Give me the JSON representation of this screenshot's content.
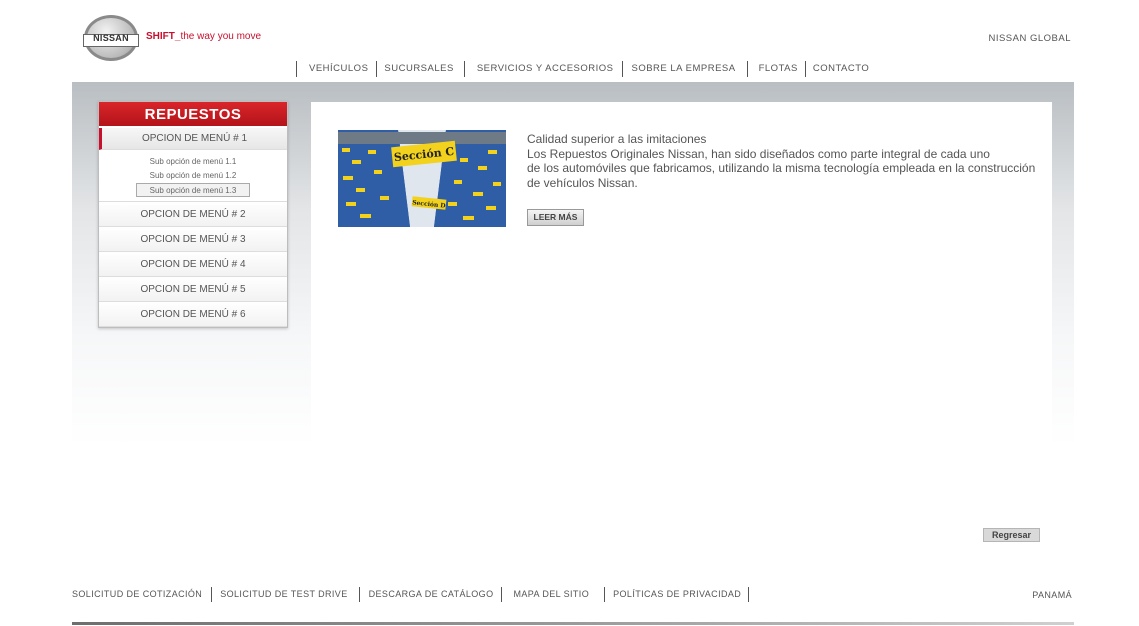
{
  "brand": {
    "logo_text": "NISSAN",
    "tagline_bold": "SHIFT_",
    "tagline_rest": "the way you move",
    "global_link": "NISSAN GLOBAL",
    "accent_color": "#c8102e"
  },
  "topnav": [
    "VEHÍCULOS",
    "SUCURSALES",
    "SERVICIOS Y ACCESORIOS",
    "SOBRE LA EMPRESA",
    "FLOTAS",
    "CONTACTO"
  ],
  "sidebar": {
    "title": "REPUESTOS",
    "items": [
      {
        "label": "OPCION DE MENÚ # 1"
      },
      {
        "label": "OPCION DE MENÚ # 2"
      },
      {
        "label": "OPCION DE MENÚ # 3"
      },
      {
        "label": "OPCION DE MENÚ # 4"
      },
      {
        "label": "OPCION DE MENÚ # 5"
      },
      {
        "label": "OPCION DE MENÚ # 6"
      }
    ],
    "subitems": [
      "Sub opción de menú 1.1",
      "Sub opción de menú 1.2",
      "Sub opción de menú 1.3"
    ]
  },
  "main": {
    "headline": "Calidad superior a las imitaciones",
    "body_lines": [
      "Los Repuestos Originales Nissan, han sido diseñados como parte integral de cada uno",
      "de los automóviles que fabricamos, utilizando la misma tecnología empleada en la construcción",
      "de vehículos Nissan."
    ],
    "read_more": "LEER MÁS",
    "photo_sign_1": "Sección C",
    "photo_sign_2": "Sección D",
    "back_button": "Regresar"
  },
  "footer": {
    "links": [
      "SOLICITUD DE COTIZACIÓN",
      "SOLICITUD DE TEST DRIVE",
      "DESCARGA DE CATÁLOGO",
      "MAPA DEL SITIO",
      "POLÍTICAS DE PRIVACIDAD"
    ],
    "country": "PANAMÁ"
  }
}
